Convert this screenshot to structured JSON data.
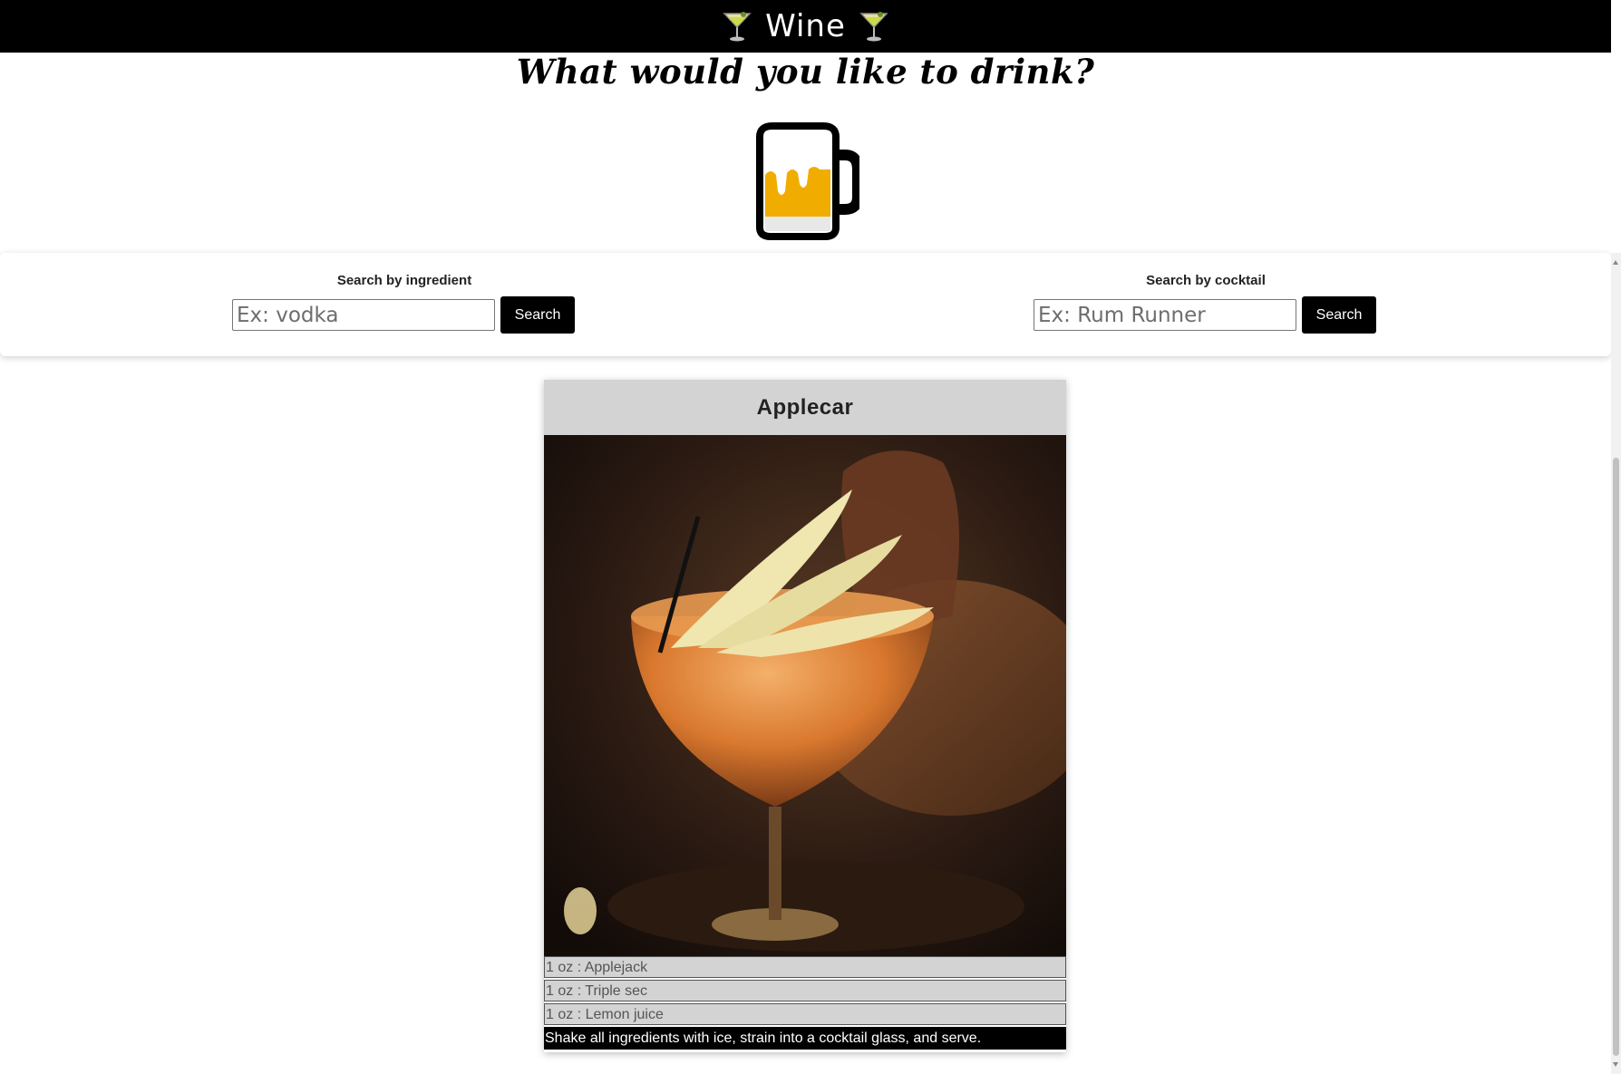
{
  "navbar": {
    "title": "Wine",
    "left_icon": "cocktail-glass-icon",
    "right_icon": "cocktail-glass-icon"
  },
  "page": {
    "headline": "What would you like to drink?",
    "hero_icon": "beer-mug-icon"
  },
  "search": {
    "ingredient": {
      "label": "Search by ingredient",
      "placeholder": "Ex: vodka",
      "value": "",
      "button_label": "Search"
    },
    "cocktail": {
      "label": "Search by cocktail",
      "placeholder": "Ex: Rum Runner",
      "value": "",
      "button_label": "Search"
    }
  },
  "result_card": {
    "name": "Applecar",
    "image_description": "cocktail in coupe glass with apple slices",
    "ingredients": [
      "1 oz : Applejack",
      "1 oz : Triple sec",
      "1 oz : Lemon juice"
    ],
    "instructions": "Shake all ingredients with ice, strain into a cocktail glass, and serve."
  },
  "colors": {
    "navbar_bg": "#000000",
    "button_bg": "#000000",
    "card_header_bg": "#d3d3d3",
    "instructions_bg": "#000000"
  }
}
